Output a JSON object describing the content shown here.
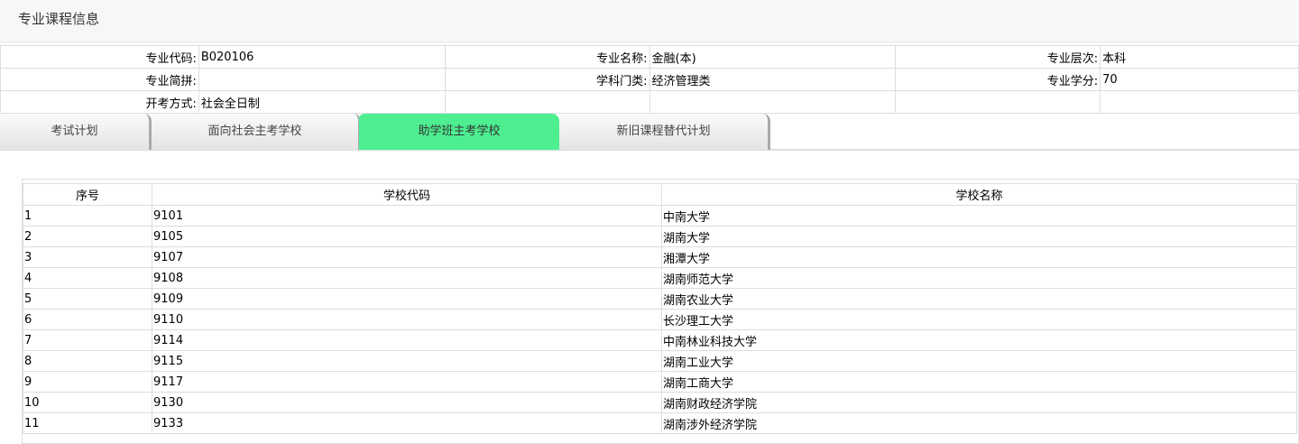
{
  "title": "专业课程信息",
  "info": [
    [
      {
        "label": "专业代码:",
        "value": "B020106"
      },
      {
        "label": "专业名称:",
        "value": "金融(本)"
      },
      {
        "label": "专业层次:",
        "value": "本科"
      }
    ],
    [
      {
        "label": "专业简拼:",
        "value": ""
      },
      {
        "label": "学科门类:",
        "value": "经济管理类"
      },
      {
        "label": "专业学分:",
        "value": "70"
      }
    ],
    [
      {
        "label": "开考方式:",
        "value": "社会全日制"
      },
      {
        "label": "",
        "value": ""
      },
      {
        "label": "",
        "value": ""
      }
    ]
  ],
  "tabs": [
    "考试计划",
    "面向社会主考学校",
    "助学班主考学校",
    "新旧课程替代计划"
  ],
  "active_tab": 2,
  "table": {
    "headers": [
      "序号",
      "学校代码",
      "学校名称"
    ],
    "rows": [
      [
        "1",
        "9101",
        "中南大学"
      ],
      [
        "2",
        "9105",
        "湖南大学"
      ],
      [
        "3",
        "9107",
        "湘潭大学"
      ],
      [
        "4",
        "9108",
        "湖南师范大学"
      ],
      [
        "5",
        "9109",
        "湖南农业大学"
      ],
      [
        "6",
        "9110",
        "长沙理工大学"
      ],
      [
        "7",
        "9114",
        "中南林业科技大学"
      ],
      [
        "8",
        "9115",
        "湖南工业大学"
      ],
      [
        "9",
        "9117",
        "湖南工商大学"
      ],
      [
        "10",
        "9130",
        "湖南财政经济学院"
      ],
      [
        "11",
        "9133",
        "湖南涉外经济学院"
      ]
    ]
  }
}
